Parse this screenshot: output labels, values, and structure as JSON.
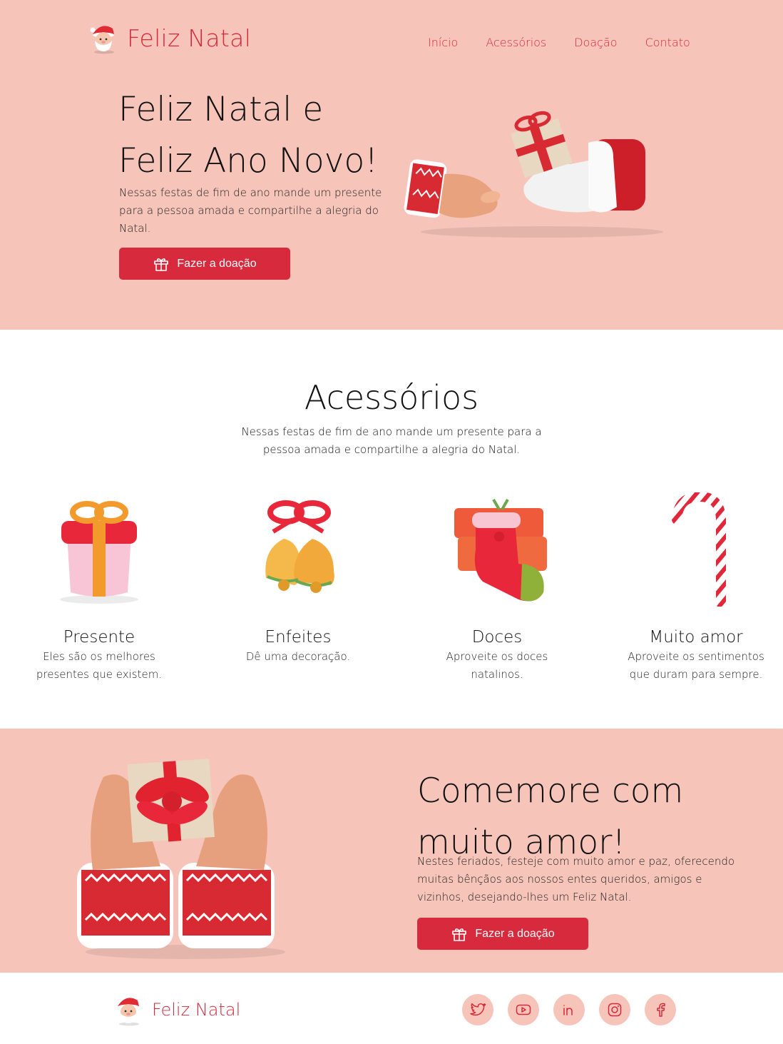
{
  "brand": {
    "name": "Feliz Natal",
    "accent": "#d42a3c",
    "pink": "#f6c4b9"
  },
  "nav": {
    "items": [
      "Início",
      "Acessórios",
      "Doação",
      "Contato"
    ]
  },
  "hero": {
    "title_line1": "Feliz Natal e",
    "title_line2": "Feliz Ano Novo!",
    "text": "Nessas festas de fim de ano mande um presente para a pessoa amada e compartilhe a alegria do Natal.",
    "cta": "Fazer a doação",
    "image": "hands-exchanging-gift-illustration"
  },
  "accessories": {
    "title": "Acessórios",
    "subtitle": "Nessas festas de fim de ano mande um presente para a pessoa amada e compartilhe a alegria do Natal.",
    "cards": [
      {
        "title": "Presente",
        "desc": "Eles são os melhores presentes que existem.",
        "icon": "gift-box-icon"
      },
      {
        "title": "Enfeites",
        "desc": "Dê uma decoração.",
        "icon": "bells-icon"
      },
      {
        "title": "Doces",
        "desc": "Aproveite os doces natalinos.",
        "icon": "stocking-icon"
      },
      {
        "title": "Muito amor",
        "desc": "Aproveite os sentimentos que duram para sempre.",
        "icon": "candy-cane-icon"
      }
    ]
  },
  "love": {
    "title_line1": "Comemore com",
    "title_line2": "muito amor!",
    "text": "Nestes feriados, festeje com muito amor e paz, oferecendo muitas bênçãos aos nossos entes queridos, amigos e vizinhos, desejando-lhes um Feliz Natal.",
    "cta": "Fazer a doação",
    "image": "hands-holding-gift-illustration"
  },
  "footer": {
    "brand": "Feliz Natal",
    "socials": [
      "twitter-icon",
      "youtube-icon",
      "linkedin-icon",
      "instagram-icon",
      "facebook-icon"
    ]
  }
}
